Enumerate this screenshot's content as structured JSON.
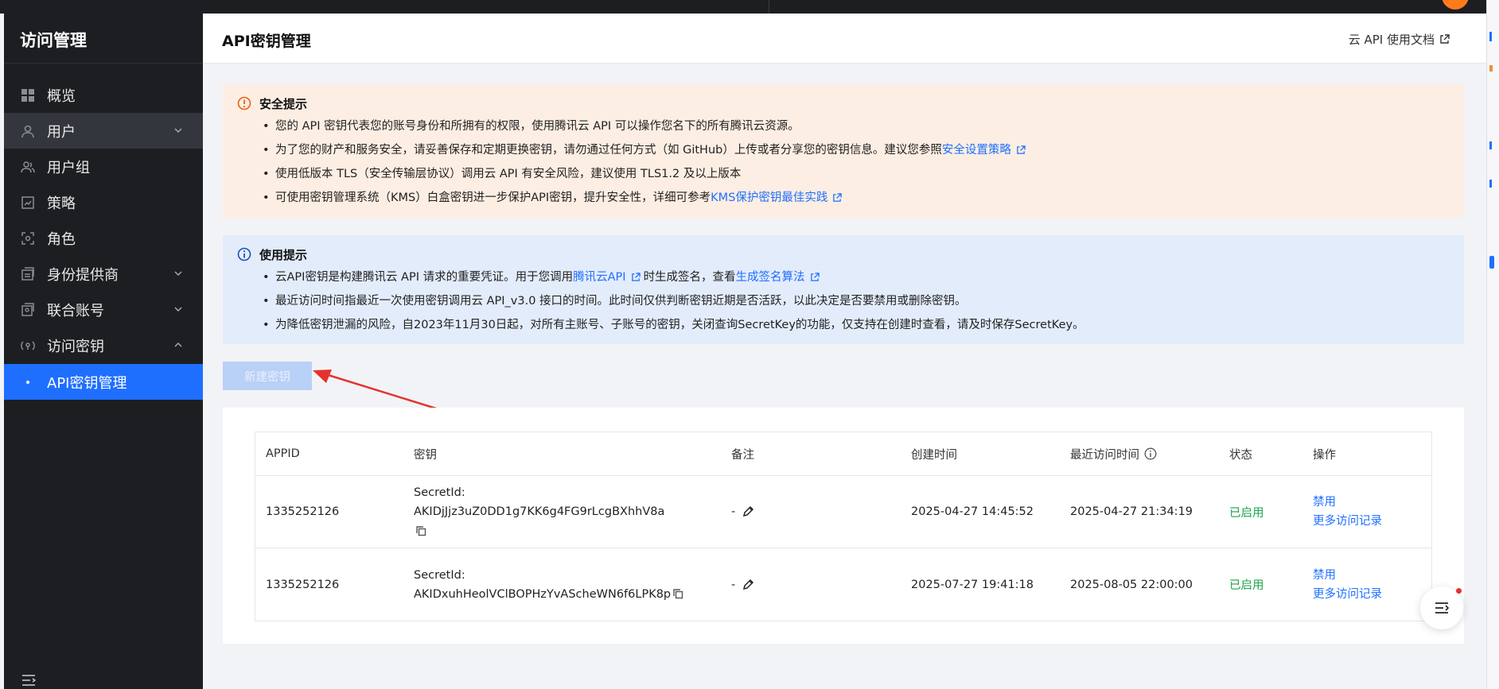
{
  "sidebar": {
    "title": "访问管理",
    "items": [
      {
        "label": "概览",
        "icon": "grid-icon"
      },
      {
        "label": "用户",
        "icon": "user-icon",
        "expandable": true
      },
      {
        "label": "用户组",
        "icon": "user-group-icon"
      },
      {
        "label": "策略",
        "icon": "policy-icon"
      },
      {
        "label": "角色",
        "icon": "role-icon"
      },
      {
        "label": "身份提供商",
        "icon": "id-provider-icon",
        "expandable": true
      },
      {
        "label": "联合账号",
        "icon": "federated-account-icon",
        "expandable": true
      },
      {
        "label": "访问密钥",
        "icon": "access-key-icon",
        "expandable": true,
        "expanded": true
      },
      {
        "label": "API密钥管理",
        "active": true
      }
    ]
  },
  "header": {
    "title": "API密钥管理",
    "doc_link": "云 API 使用文档"
  },
  "security_tip": {
    "title": "安全提示",
    "items": [
      {
        "text": "您的 API 密钥代表您的账号身份和所拥有的权限，使用腾讯云 API 可以操作您名下的所有腾讯云资源。"
      },
      {
        "text": "为了您的财产和服务安全，请妥善保存和定期更换密钥，请勿通过任何方式（如 GitHub）上传或者分享您的密钥信息。建议您参照",
        "link": "安全设置策略"
      },
      {
        "text": "使用低版本 TLS（安全传输层协议）调用云 API 有安全风险，建议使用 TLS1.2 及以上版本"
      },
      {
        "text": "可使用密钥管理系统（KMS）白盒密钥进一步保护API密钥，提升安全性，详细可参考",
        "link": "KMS保护密钥最佳实践"
      }
    ]
  },
  "usage_tip": {
    "title": "使用提示",
    "item1": {
      "pre": "云API密钥是构建腾讯云 API 请求的重要凭证。用于您调用",
      "link1": "腾讯云API",
      "mid": "时生成签名，查看",
      "link2": "生成签名算法"
    },
    "item2": "最近访问时间指最近一次使用密钥调用云 API_v3.0 接口的时间。此时间仅供判断密钥近期是否活跃，以此决定是否要禁用或删除密钥。",
    "item3": "为降低密钥泄漏的风险，自2023年11月30日起，对所有主账号、子账号的密钥，关闭查询SecretKey的功能，仅支持在创建时查看，请及时保存SecretKey。"
  },
  "new_key_button": "新建密钥",
  "table": {
    "columns": [
      "APPID",
      "密钥",
      "备注",
      "创建时间",
      "最近访问时间",
      "状态",
      "操作"
    ],
    "rows": [
      {
        "appid": "1335252126",
        "secret_line1": "SecretId: AKIDjJjz3uZ0DD1g7KK6g4FG9rLcgBXhhV8a",
        "secret_line2": "",
        "remark": "-",
        "created": "2025-04-27 14:45:52",
        "last_access": "2025-04-27 21:34:19",
        "status": "已启用",
        "op_disable": "禁用",
        "op_more": "更多访问记录"
      },
      {
        "appid": "1335252126",
        "secret_line1": "SecretId:",
        "secret_line2": "AKIDxuhHeolVClBOPHzYvAScheWN6f6LPK8p",
        "remark": "-",
        "created": "2025-07-27 19:41:18",
        "last_access": "2025-08-05 22:00:00",
        "status": "已启用",
        "op_disable": "禁用",
        "op_more": "更多访问记录"
      }
    ]
  },
  "colors": {
    "accent": "#1f6fff",
    "sidebar_bg": "#1c1e22",
    "warn_bg": "#fdeee3",
    "info_bg": "#e3ecfb",
    "status_on": "#1aa34a",
    "arrow": "#e5322d"
  }
}
